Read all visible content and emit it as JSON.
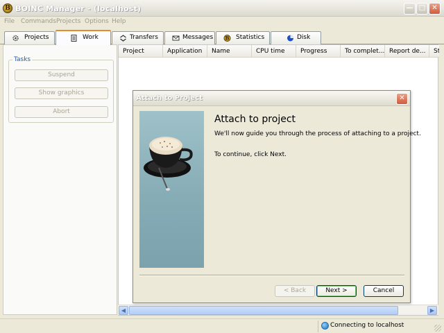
{
  "window": {
    "title": "BOINC Manager - (localhost)",
    "app_icon_letter": "B"
  },
  "menu": [
    "File",
    "Commands",
    "Projects",
    "Options",
    "Help"
  ],
  "tabs": [
    {
      "label": "Projects",
      "icon": "gear-icon"
    },
    {
      "label": "Work",
      "icon": "document-icon",
      "active": true
    },
    {
      "label": "Transfers",
      "icon": "transfer-icon"
    },
    {
      "label": "Messages",
      "icon": "envelope-icon"
    },
    {
      "label": "Statistics",
      "icon": "boinc-icon"
    },
    {
      "label": "Disk",
      "icon": "pie-icon"
    }
  ],
  "tasks": {
    "legend": "Tasks",
    "buttons": [
      "Suspend",
      "Show graphics",
      "Abort"
    ]
  },
  "list": {
    "columns": [
      "Project",
      "Application",
      "Name",
      "CPU time",
      "Progress",
      "To complet...",
      "Report de...",
      "St"
    ]
  },
  "status": {
    "connection": "Connecting to localhost"
  },
  "dialog": {
    "title": "Attach to Project",
    "heading": "Attach to project",
    "text1": "We'll now guide you through the process of attaching to a project.",
    "text2": "To continue, click Next.",
    "buttons": {
      "back": "< Back",
      "next": "Next >",
      "cancel": "Cancel"
    }
  },
  "colors": {
    "accent_tab": "#e68b2c",
    "task_legend": "#1d5ab8",
    "close_button": "#d25a3b"
  }
}
